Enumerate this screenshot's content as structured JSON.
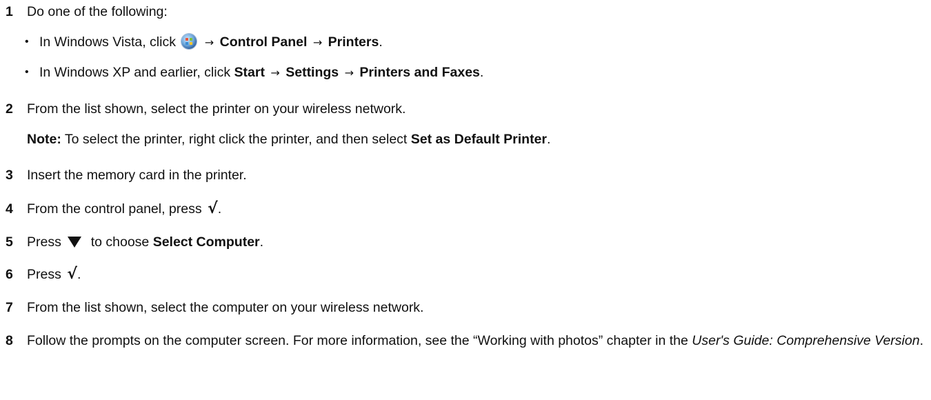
{
  "steps": [
    {
      "num": "1",
      "text": "Do one of the following:",
      "bullets": [
        {
          "pre": "In Windows Vista, click",
          "icon": "windows-start-orb-icon",
          "arrow1": "→",
          "b1": "Control Panel",
          "arrow2": "→",
          "b2": "Printers",
          "post": "."
        },
        {
          "pre": "In Windows XP and earlier, click",
          "b1": "Start",
          "arrow1": "→",
          "b2": "Settings",
          "arrow2": "→",
          "b3": "Printers and Faxes",
          "post": "."
        }
      ]
    },
    {
      "num": "2",
      "text": "From the list shown, select the printer on your wireless network.",
      "note": {
        "label": "Note:",
        "text": "To select the printer, right click the printer, and then select",
        "bold": "Set as Default Printer",
        "post": "."
      }
    },
    {
      "num": "3",
      "text": "Insert the memory card in the printer."
    },
    {
      "num": "4",
      "text": "From the control panel, press",
      "icon": "check-icon",
      "symbol": "√",
      "post": "."
    },
    {
      "num": "5",
      "pre": "Press",
      "icon": "down-triangle-icon",
      "mid": "to choose",
      "bold": "Select Computer",
      "post": "."
    },
    {
      "num": "6",
      "pre": "Press",
      "icon": "check-icon",
      "symbol": "√",
      "post": "."
    },
    {
      "num": "7",
      "text": "From the list shown, select the computer on your wireless network."
    },
    {
      "num": "8",
      "text": "Follow the prompts on the computer screen. For more information, see the “Working with photos” chapter in the",
      "italic": "User's Guide: Comprehensive Version",
      "post": "."
    }
  ]
}
